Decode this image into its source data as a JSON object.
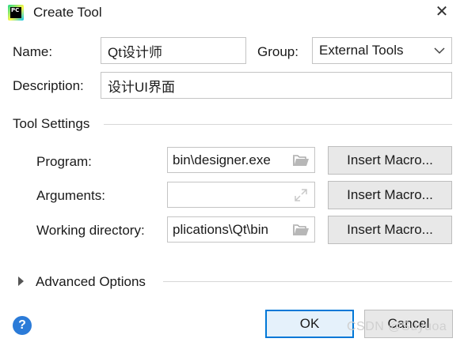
{
  "window": {
    "title": "Create Tool",
    "app_icon_text": "PC",
    "close_glyph": "✕"
  },
  "form": {
    "name_label": "Name:",
    "name_value": "Qt设计师",
    "group_label": "Group:",
    "group_value": "External Tools",
    "description_label": "Description:",
    "description_value": "设计UI界面"
  },
  "tool_settings": {
    "section_title": "Tool Settings",
    "program_label": "Program:",
    "program_value": "bin\\designer.exe",
    "arguments_label": "Arguments:",
    "arguments_value": "",
    "working_dir_label": "Working directory:",
    "working_dir_value": "plications\\Qt\\bin",
    "insert_macro_label": "Insert Macro..."
  },
  "advanced": {
    "label": "Advanced Options"
  },
  "footer": {
    "ok_label": "OK",
    "cancel_label": "Cancel",
    "help_glyph": "?"
  },
  "watermark": "CSDN @Suyuoa",
  "icons": {
    "folder": "folder-icon",
    "expand": "expand-icon",
    "chevron": "chevron-down-icon",
    "triangle": "triangle-right-icon"
  }
}
